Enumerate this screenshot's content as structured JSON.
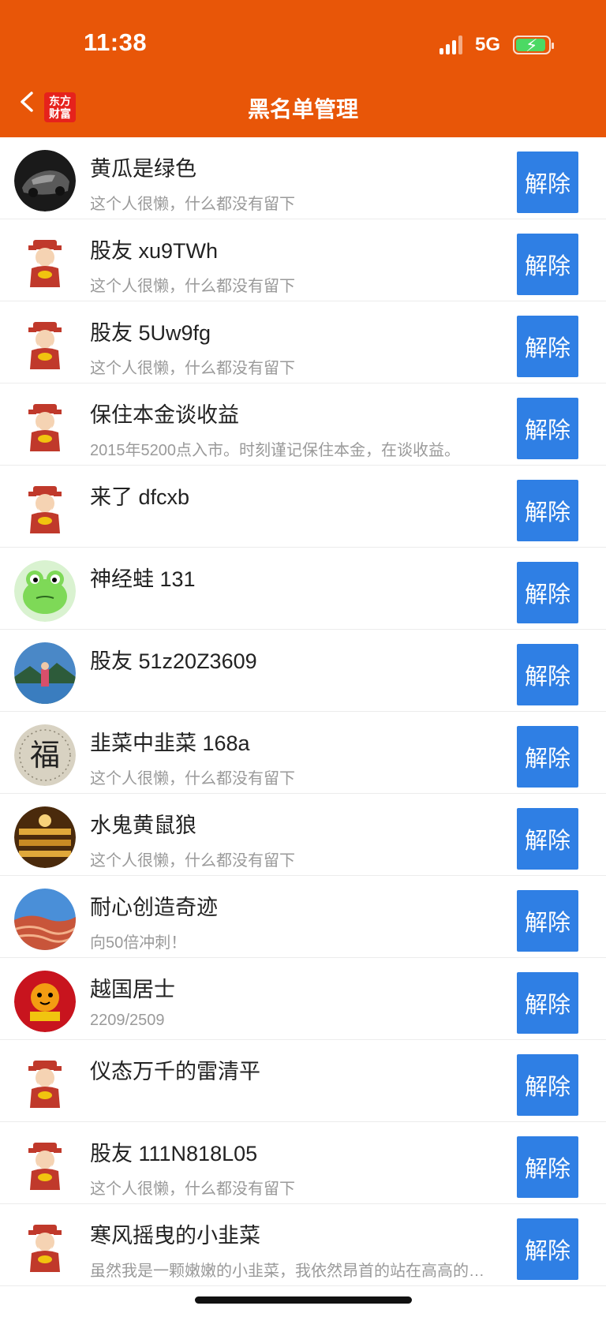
{
  "status_bar": {
    "time": "11:38",
    "network": "5G"
  },
  "header": {
    "title": "黑名单管理",
    "logo_line1": "东方",
    "logo_line2": "财富"
  },
  "unblock_label": "解除",
  "rows": [
    {
      "name": "黄瓜是绿色",
      "desc": "这个人很懒，什么都没有留下",
      "avatar": "car-avatar"
    },
    {
      "name": "股友 xu9TWh",
      "desc": "这个人很懒，什么都没有留下",
      "avatar": "fortune-god-avatar"
    },
    {
      "name": "股友 5Uw9fg",
      "desc": "这个人很懒，什么都没有留下",
      "avatar": "fortune-god-avatar"
    },
    {
      "name": "保住本金谈收益",
      "desc": "2015年5200点入市。时刻谨记保住本金，在谈收益。",
      "avatar": "fortune-god-avatar"
    },
    {
      "name": "来了 dfcxb",
      "desc": "",
      "avatar": "fortune-god-avatar"
    },
    {
      "name": "神经蛙 131",
      "desc": "",
      "avatar": "frog-avatar"
    },
    {
      "name": "股友 51z20Z3609",
      "desc": "",
      "avatar": "photo-avatar"
    },
    {
      "name": "韭菜中韭菜 168a",
      "desc": "这个人很懒，什么都没有留下",
      "avatar": "fu-character-avatar"
    },
    {
      "name": "水鬼黄鼠狼",
      "desc": "这个人很懒，什么都没有留下",
      "avatar": "golden-hall-avatar"
    },
    {
      "name": "耐心创造奇迹",
      "desc": "向50倍冲刺！",
      "avatar": "canyon-avatar"
    },
    {
      "name": "越国居士",
      "desc": "2209/2509",
      "avatar": "tiger-avatar"
    },
    {
      "name": "仪态万千的雷清平",
      "desc": "",
      "avatar": "fortune-god-avatar"
    },
    {
      "name": "股友 111N818L05",
      "desc": "这个人很懒，什么都没有留下",
      "avatar": "fortune-god-avatar"
    },
    {
      "name": "寒风摇曳的小韭菜",
      "desc": "虽然我是一颗嫩嫩的小韭菜，我依然昂首的站在高高的…",
      "avatar": "fortune-god-avatar"
    }
  ]
}
